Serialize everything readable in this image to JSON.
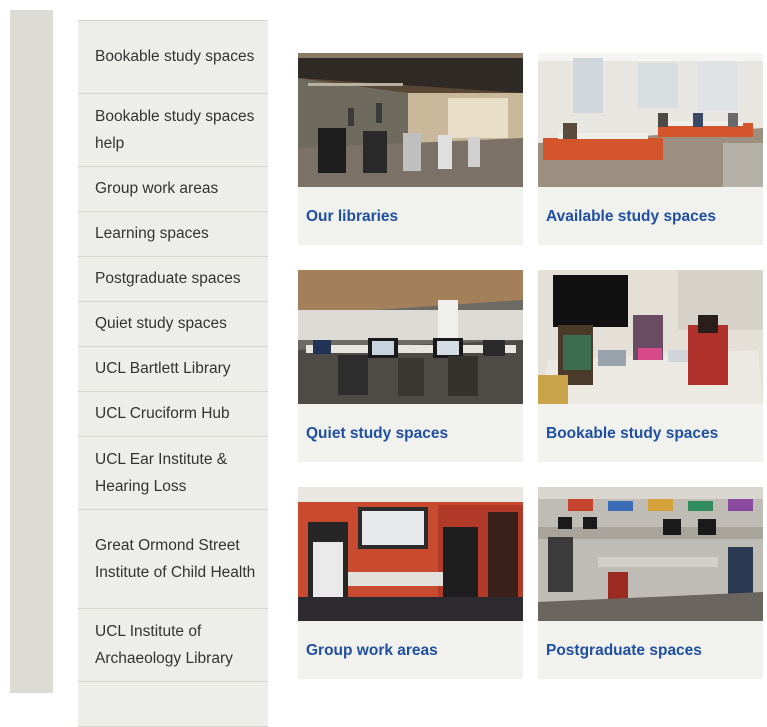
{
  "sidebar": {
    "items": [
      {
        "label": "Bookable study spaces"
      },
      {
        "label": "Bookable study spaces help"
      },
      {
        "label": "Group work areas"
      },
      {
        "label": "Learning spaces"
      },
      {
        "label": "Postgraduate spaces"
      },
      {
        "label": "Quiet study spaces"
      },
      {
        "label": "UCL Bartlett Library"
      },
      {
        "label": "UCL Cruciform Hub"
      },
      {
        "label": "UCL Ear Institute & Hearing Loss"
      },
      {
        "label": "Great Ormond Street Institute of Child Health"
      },
      {
        "label": "UCL Institute of Archaeology Library"
      }
    ]
  },
  "cards": [
    {
      "title": "Our libraries"
    },
    {
      "title": "Available study spaces"
    },
    {
      "title": "Quiet study spaces"
    },
    {
      "title": "Bookable study spaces"
    },
    {
      "title": "Group work areas"
    },
    {
      "title": "Postgraduate spaces"
    }
  ],
  "colors": {
    "link": "#1f4fa0",
    "card_bg": "#f1f1ed",
    "sidebar_bg": "#ededea",
    "gutter": "#dcdcd5"
  }
}
